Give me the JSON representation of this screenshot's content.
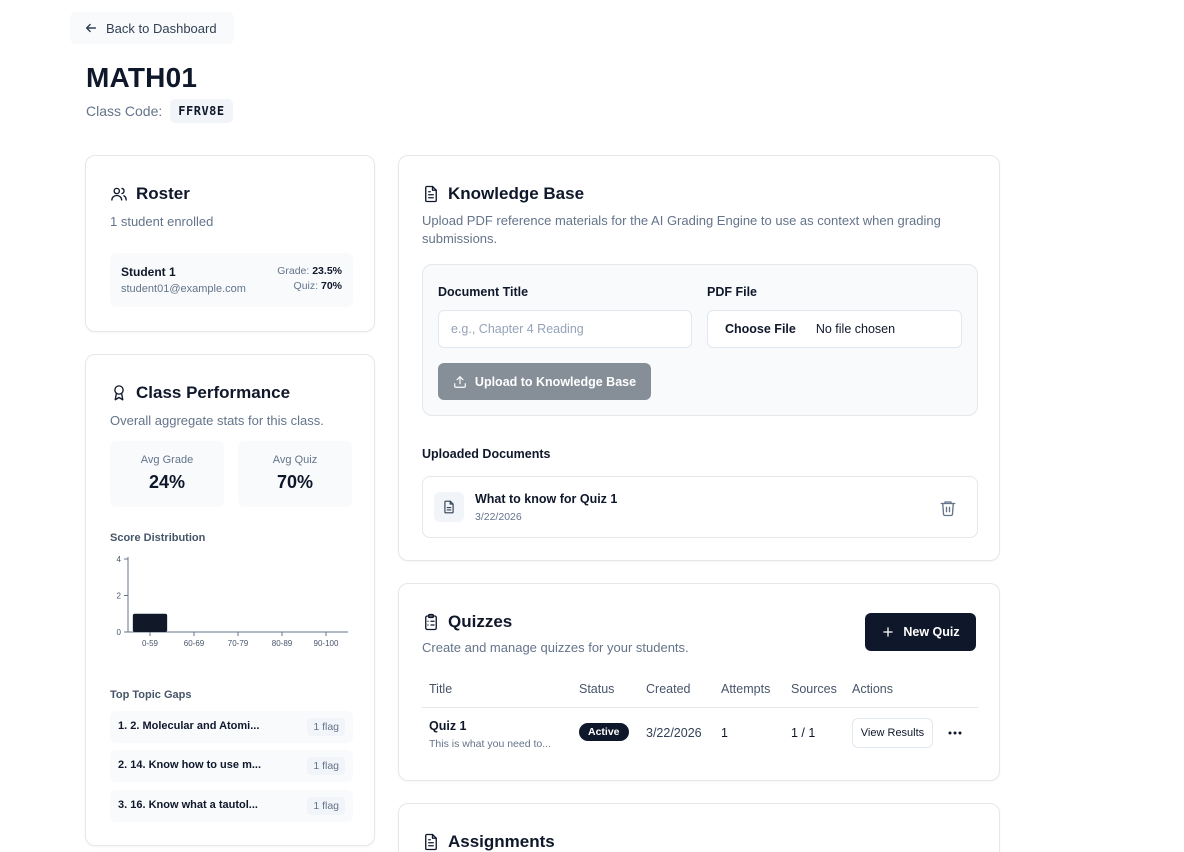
{
  "nav": {
    "back_label": "Back to Dashboard"
  },
  "class": {
    "title": "MATH01",
    "code_label": "Class Code:",
    "code": "FFRV8E"
  },
  "roster": {
    "title": "Roster",
    "subtitle": "1 student enrolled",
    "students": [
      {
        "name": "Student 1",
        "email": "student01@example.com",
        "grade_label": "Grade:",
        "grade": "23.5%",
        "quiz_label": "Quiz:",
        "quiz": "70%"
      }
    ]
  },
  "performance": {
    "title": "Class Performance",
    "subtitle": "Overall aggregate stats for this class.",
    "avg_grade_label": "Avg Grade",
    "avg_grade": "24%",
    "avg_quiz_label": "Avg Quiz",
    "avg_quiz": "70%",
    "distribution_label": "Score Distribution",
    "gaps_label": "Top Topic Gaps",
    "gaps": [
      {
        "text": "1. 2. Molecular and Atomi...",
        "flag": "1 flag"
      },
      {
        "text": "2. 14. Know how to use m...",
        "flag": "1 flag"
      },
      {
        "text": "3. 16. Know what a tautol...",
        "flag": "1 flag"
      }
    ]
  },
  "chart_data": {
    "type": "bar",
    "title": "Score Distribution",
    "categories": [
      "0-59",
      "60-69",
      "70-79",
      "80-89",
      "90-100"
    ],
    "values": [
      1,
      0,
      0,
      0,
      0
    ],
    "ylim": [
      0,
      4
    ],
    "yticks": [
      0,
      2,
      4
    ],
    "bar_color": "#111827"
  },
  "knowledge_base": {
    "title": "Knowledge Base",
    "subtitle": "Upload PDF reference materials for the AI Grading Engine to use as context when grading submissions.",
    "doc_title_label": "Document Title",
    "doc_title_placeholder": "e.g., Chapter 4 Reading",
    "pdf_label": "PDF File",
    "choose_file": "Choose File",
    "no_file": "No file chosen",
    "upload_button": "Upload to Knowledge Base",
    "uploaded_label": "Uploaded Documents",
    "documents": [
      {
        "name": "What to know for Quiz 1",
        "date": "3/22/2026"
      }
    ]
  },
  "quizzes": {
    "title": "Quizzes",
    "subtitle": "Create and manage quizzes for your students.",
    "new_button": "New Quiz",
    "columns": [
      "Title",
      "Status",
      "Created",
      "Attempts",
      "Sources",
      "Actions"
    ],
    "rows": [
      {
        "title": "Quiz 1",
        "description": "This is what you need to...",
        "status": "Active",
        "created": "3/22/2026",
        "attempts": "1",
        "sources": "1 / 1",
        "action": "View Results"
      }
    ]
  },
  "assignments": {
    "title": "Assignments"
  },
  "colors": {
    "primary": "#0f172a",
    "muted": "#64748b",
    "disabled_button": "#868e98",
    "panel_bg": "#f8fafc",
    "border": "#e5e7eb"
  }
}
